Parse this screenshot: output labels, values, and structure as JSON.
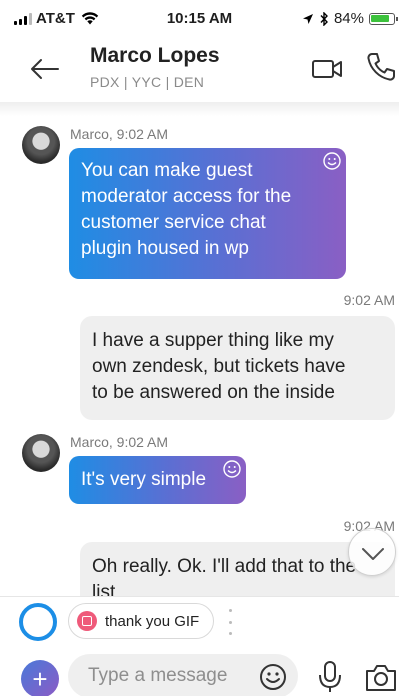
{
  "status_bar": {
    "carrier": "AT&T",
    "time": "10:15 AM",
    "battery": "84%",
    "battery_level": 0.84
  },
  "header": {
    "contact_name": "Marco Lopes",
    "contact_subtitle": "PDX | YYC | DEN"
  },
  "messages": [
    {
      "direction": "incoming",
      "meta": "Marco, 9:02 AM",
      "lines": [
        "You can make guest",
        "moderator access for the",
        "customer service chat",
        "plugin housed in wp"
      ]
    },
    {
      "direction": "outgoing",
      "time": "9:02 AM",
      "lines": [
        "I have a supper thing like my",
        "own zendesk, but tickets have",
        "to be answered on the inside"
      ]
    },
    {
      "direction": "incoming",
      "meta": "Marco, 9:02 AM",
      "lines": [
        "It's very simple"
      ]
    },
    {
      "direction": "outgoing",
      "time": "9:02 AM",
      "lines": [
        "Oh really. Ok. I'll add that to the",
        "list"
      ]
    }
  ],
  "suggestions": {
    "chip_label": "thank you GIF"
  },
  "composer": {
    "placeholder": "Type a message",
    "value": ""
  },
  "colors": {
    "accent": "#1c8ee6",
    "bubble_gradient_start": "#1f8de4",
    "bubble_gradient_end": "#8a5fc4",
    "outgoing_bubble": "#efefef"
  },
  "icons": [
    "signal-icon",
    "wifi-icon",
    "location-arrow-icon",
    "bluetooth-icon",
    "battery-icon",
    "back-arrow-icon",
    "video-camera-icon",
    "phone-icon",
    "smiley-icon",
    "chevron-down-icon",
    "gif-icon",
    "more-dots-icon",
    "plus-icon",
    "emoji-icon",
    "microphone-icon",
    "camera-icon"
  ]
}
